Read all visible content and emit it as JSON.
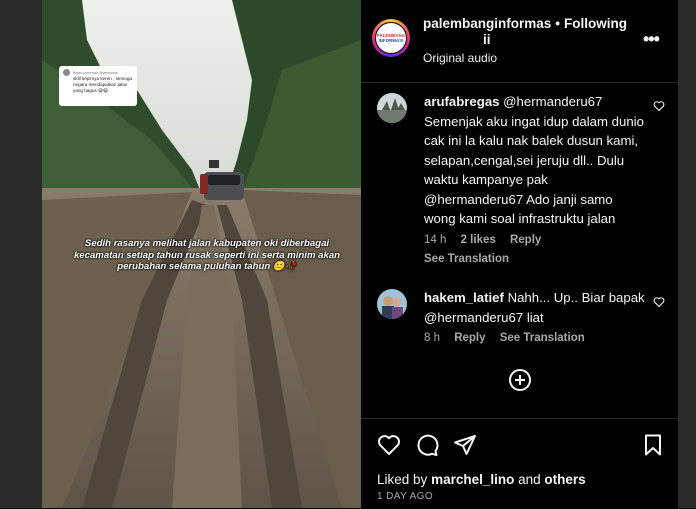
{
  "media": {
    "sticker_header": "Balas komentar @yemiwiria",
    "sticker_text": "skill kepimya keren , semoga negara mendapatkan jalan yang bagus 😄😄",
    "caption": "Sedih rasanya melihat jalan kabupaten oki diberbagai kecamatan setiap tahun rusak seperti ini serta minim akan perubahan selama puluhan tahun 🙂🥀"
  },
  "post": {
    "username": "palembanginformasi",
    "username_line1": "palembanginformas",
    "username_line2": "ii",
    "separator": "•",
    "follow_status": "Following",
    "audio": "Original audio",
    "logo_line1": "PALEMBANG",
    "logo_line2": "INFORMASI",
    "more_icon": "more-horizontal-icon"
  },
  "comments": [
    {
      "username": "arufabregas",
      "text": "@hermanderu67 Semenjak aku ingat idup dalam dunio cak ini la kalu nak balek dusun kami, selapan,cengal,sei jeruju dll.. Dulu waktu kampanye pak @hermanderu67 Ado janji samo wong kami soal infrastruktu jalan",
      "time": "14 h",
      "likes": "2 likes",
      "reply": "Reply",
      "translation": "See Translation"
    },
    {
      "username": "hakem_latief",
      "text": "Nahh... Up.. Biar bapak @hermanderu67 liat",
      "time": "8 h",
      "reply": "Reply",
      "translation": "See Translation"
    }
  ],
  "footer": {
    "liked_prefix": "Liked by",
    "liked_user": "marchel_lino",
    "liked_and": "and",
    "liked_others": "others",
    "date": "1 DAY AGO"
  },
  "icons": {
    "heart": "heart-icon",
    "comment": "comment-icon",
    "share": "share-icon",
    "bookmark": "bookmark-icon",
    "add": "plus-circle-icon"
  },
  "colors": {
    "background": "#000000",
    "text": "#f5f5f5",
    "secondary_text": "#a8a8a8",
    "divider": "#262626",
    "side_gutter": "#2b2b2b"
  }
}
